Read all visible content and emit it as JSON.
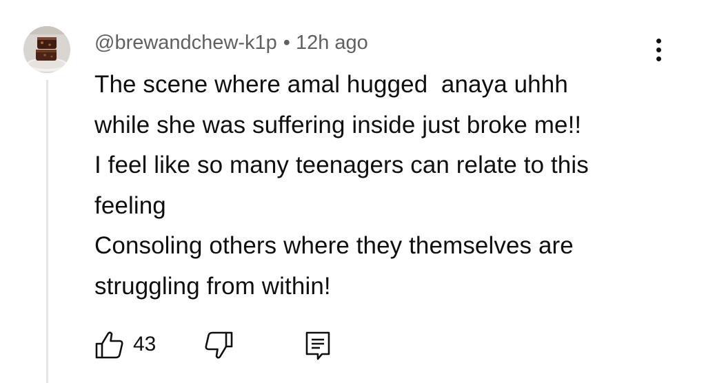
{
  "comment": {
    "author": "@brewandchew-k1p",
    "separator": "•",
    "time": "12h ago",
    "lines": [
      "The scene where amal hugged  anaya uhhh",
      "while she was suffering inside just broke me!!",
      "I feel like so many teenagers can relate to this",
      "feeling",
      "Consoling others where they themselves are",
      "struggling from within!"
    ],
    "like_count": "43"
  },
  "icons": {
    "avatar": "brownie-avatar",
    "more": "more-vertical-icon",
    "like": "thumbs-up-icon",
    "dislike": "thumbs-down-icon",
    "reply": "reply-comment-icon"
  },
  "colors": {
    "text": "#0f0f0f",
    "meta": "#606060",
    "thread_line": "#e5e5e5",
    "background": "#ffffff"
  }
}
